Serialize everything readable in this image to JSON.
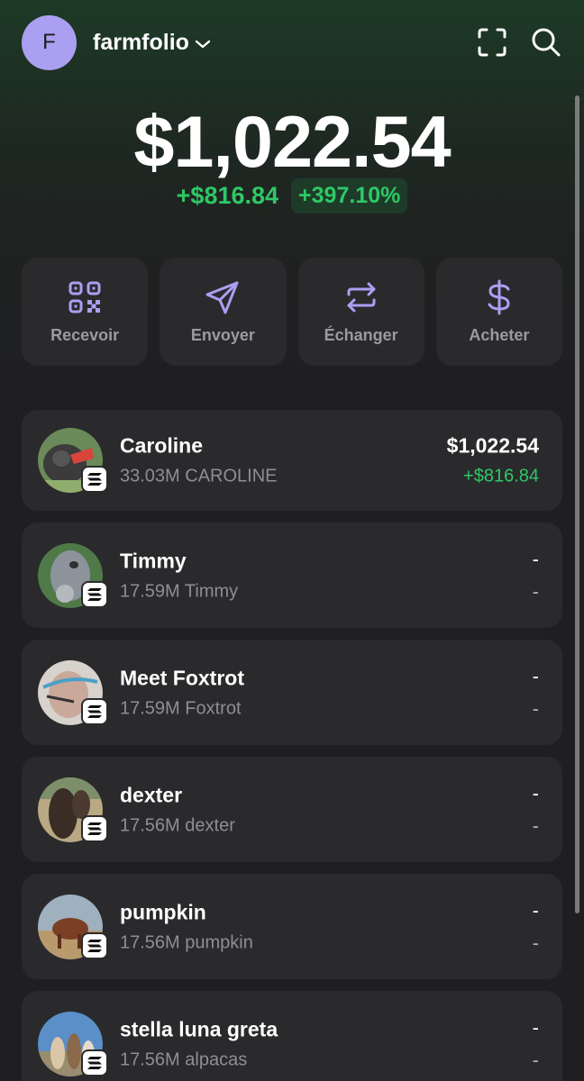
{
  "header": {
    "avatar_letter": "F",
    "account_name": "farmfolio",
    "chevron_icon": "chevron-down-icon",
    "scan_icon": "scan-icon",
    "search_icon": "search-icon"
  },
  "portfolio": {
    "balance": "$1,022.54",
    "change_abs": "+$816.84",
    "change_pct": "+397.10%"
  },
  "actions": [
    {
      "label": "Recevoir",
      "icon": "qr-code-icon"
    },
    {
      "label": "Envoyer",
      "icon": "send-icon"
    },
    {
      "label": "Échanger",
      "icon": "swap-icon"
    },
    {
      "label": "Acheter",
      "icon": "dollar-icon"
    }
  ],
  "tokens": [
    {
      "name": "Caroline",
      "sub": "33.03M CAROLINE",
      "value": "$1,022.54",
      "change": "+$816.84"
    },
    {
      "name": "Timmy",
      "sub": "17.59M Timmy",
      "value": "-",
      "change": "-"
    },
    {
      "name": "Meet Foxtrot",
      "sub": "17.59M Foxtrot",
      "value": "-",
      "change": "-"
    },
    {
      "name": "dexter",
      "sub": "17.56M dexter",
      "value": "-",
      "change": "-"
    },
    {
      "name": "pumpkin",
      "sub": "17.56M pumpkin",
      "value": "-",
      "change": "-"
    },
    {
      "name": "stella luna greta",
      "sub": "17.56M alpacas",
      "value": "-",
      "change": "-"
    }
  ],
  "colors": {
    "accent": "#ab9ff2",
    "positive": "#2ec866",
    "card": "#2a2a2d"
  }
}
